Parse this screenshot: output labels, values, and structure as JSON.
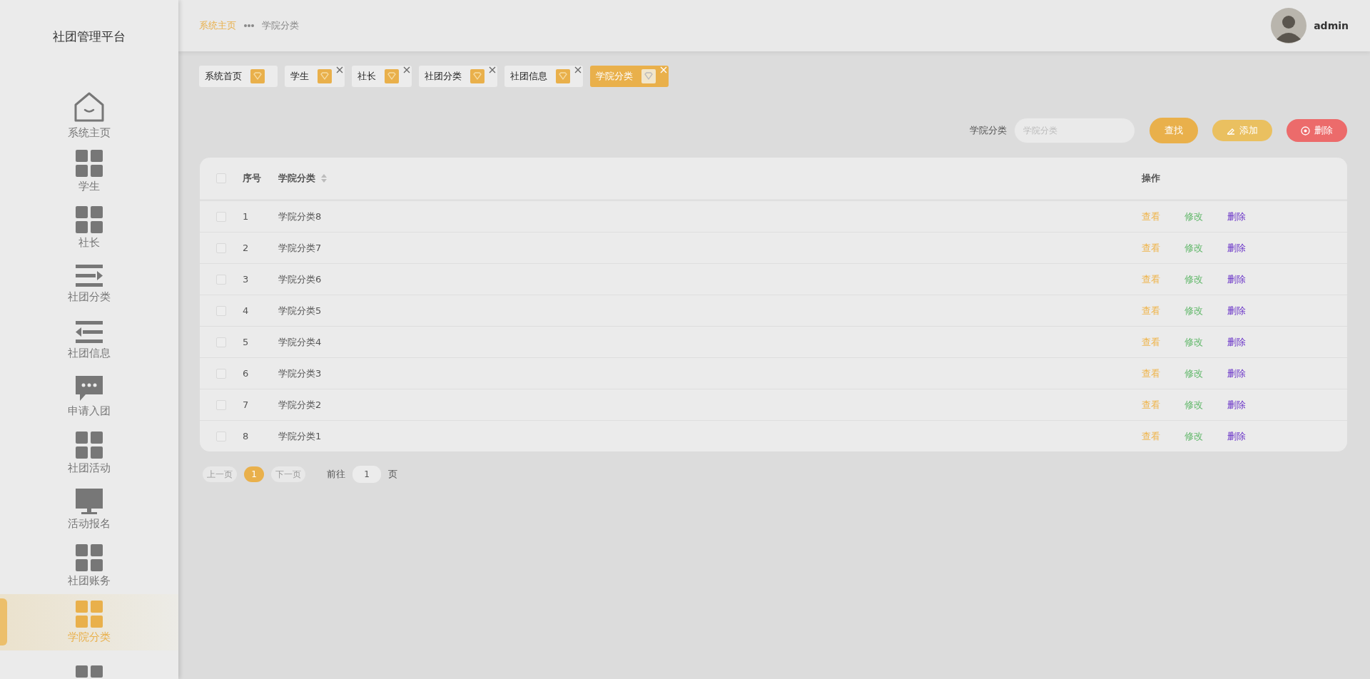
{
  "sidebar": {
    "title": "社团管理平台",
    "items": [
      {
        "label": "系统主页",
        "kind": "home",
        "selected": false
      },
      {
        "label": "学生",
        "kind": "grid",
        "selected": false
      },
      {
        "label": "社长",
        "kind": "grid",
        "selected": false
      },
      {
        "label": "社团分类",
        "kind": "indent",
        "selected": false
      },
      {
        "label": "社团信息",
        "kind": "outdent",
        "selected": false
      },
      {
        "label": "申请入团",
        "kind": "chat",
        "selected": false
      },
      {
        "label": "社团活动",
        "kind": "grid",
        "selected": false
      },
      {
        "label": "活动报名",
        "kind": "monitor",
        "selected": false
      },
      {
        "label": "社团账务",
        "kind": "grid",
        "selected": false
      },
      {
        "label": "学院分类",
        "kind": "grid",
        "selected": true
      },
      {
        "kind": "grid",
        "selected": false
      }
    ]
  },
  "header": {
    "breadcrumb": [
      "系统主页",
      "学院分类"
    ],
    "user": "admin"
  },
  "tags": [
    {
      "label": "系统首页",
      "closable": false,
      "selected": false
    },
    {
      "label": "学生",
      "closable": true,
      "selected": false
    },
    {
      "label": "社长",
      "closable": true,
      "selected": false
    },
    {
      "label": "社团分类",
      "closable": true,
      "selected": false
    },
    {
      "label": "社团信息",
      "closable": true,
      "selected": false
    },
    {
      "label": "学院分类",
      "closable": true,
      "selected": true
    }
  ],
  "search": {
    "label": "学院分类",
    "placeholder": "学院分类"
  },
  "buttons": [
    {
      "label": "查找",
      "kind": "search"
    },
    {
      "label": "添加",
      "kind": "add"
    },
    {
      "label": "删除",
      "kind": "delete"
    }
  ],
  "table": {
    "all_checked": false,
    "columns": [
      "序号",
      "学院分类",
      "操作"
    ],
    "rows": [
      {
        "index": "1",
        "name": "学院分类8",
        "checked": false,
        "actions": [
          {
            "label": "查看",
            "kind": "view"
          },
          {
            "label": "修改",
            "kind": "edit"
          },
          {
            "label": "删除",
            "kind": "delete"
          }
        ]
      },
      {
        "index": "2",
        "name": "学院分类7",
        "checked": false,
        "actions": [
          {
            "label": "查看",
            "kind": "view"
          },
          {
            "label": "修改",
            "kind": "edit"
          },
          {
            "label": "删除",
            "kind": "delete"
          }
        ]
      },
      {
        "index": "3",
        "name": "学院分类6",
        "checked": false,
        "actions": [
          {
            "label": "查看",
            "kind": "view"
          },
          {
            "label": "修改",
            "kind": "edit"
          },
          {
            "label": "删除",
            "kind": "delete"
          }
        ]
      },
      {
        "index": "4",
        "name": "学院分类5",
        "checked": false,
        "actions": [
          {
            "label": "查看",
            "kind": "view"
          },
          {
            "label": "修改",
            "kind": "edit"
          },
          {
            "label": "删除",
            "kind": "delete"
          }
        ]
      },
      {
        "index": "5",
        "name": "学院分类4",
        "checked": false,
        "actions": [
          {
            "label": "查看",
            "kind": "view"
          },
          {
            "label": "修改",
            "kind": "edit"
          },
          {
            "label": "删除",
            "kind": "delete"
          }
        ]
      },
      {
        "index": "6",
        "name": "学院分类3",
        "checked": false,
        "actions": [
          {
            "label": "查看",
            "kind": "view"
          },
          {
            "label": "修改",
            "kind": "edit"
          },
          {
            "label": "删除",
            "kind": "delete"
          }
        ]
      },
      {
        "index": "7",
        "name": "学院分类2",
        "checked": false,
        "actions": [
          {
            "label": "查看",
            "kind": "view"
          },
          {
            "label": "修改",
            "kind": "edit"
          },
          {
            "label": "删除",
            "kind": "delete"
          }
        ]
      },
      {
        "index": "8",
        "name": "学院分类1",
        "checked": false,
        "actions": [
          {
            "label": "查看",
            "kind": "view"
          },
          {
            "label": "修改",
            "kind": "edit"
          },
          {
            "label": "删除",
            "kind": "delete"
          }
        ]
      }
    ]
  },
  "pagination": {
    "prev": "上一页",
    "pages": [
      {
        "label": "1",
        "selected": true
      }
    ],
    "next": "下一页",
    "goto_label": "前往",
    "goto_value": "1",
    "page_unit": "页"
  }
}
